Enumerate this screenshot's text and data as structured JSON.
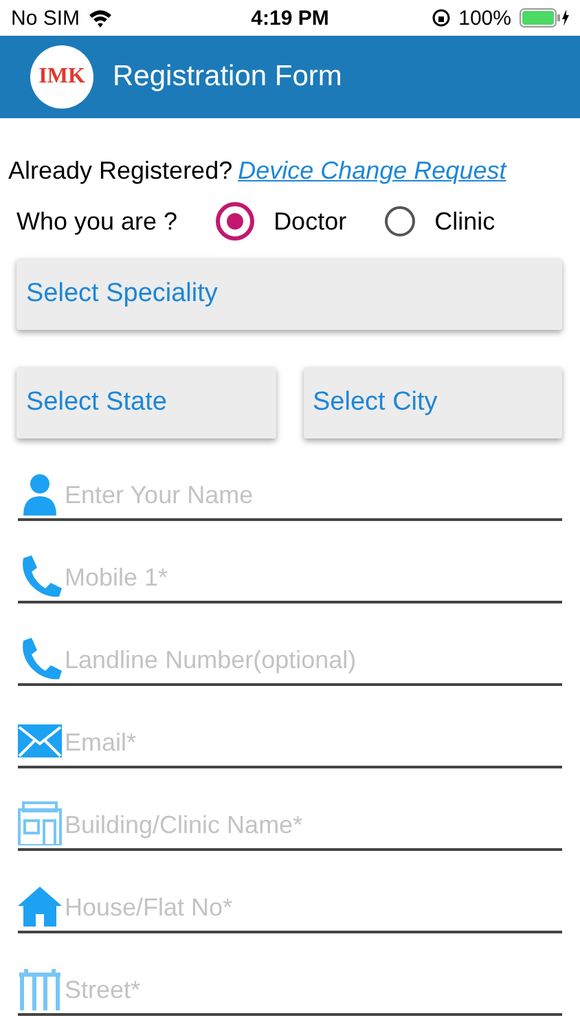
{
  "status_bar": {
    "carrier": "No SIM",
    "time": "4:19 PM",
    "battery": "100%"
  },
  "header": {
    "logo": "IMK",
    "title": "Registration Form"
  },
  "registered": {
    "text": "Already Registered?",
    "link": "Device Change Request"
  },
  "role": {
    "label": "Who you are ?",
    "options": [
      {
        "label": "Doctor",
        "selected": true
      },
      {
        "label": "Clinic",
        "selected": false
      }
    ]
  },
  "dropdowns": [
    {
      "placeholder": "Select Speciality"
    }
  ],
  "dropdown_pair": [
    {
      "placeholder": "Select State"
    },
    {
      "placeholder": "Select City"
    }
  ],
  "fields": [
    {
      "kind": "person",
      "placeholder": "Enter Your Name"
    },
    {
      "kind": "phone",
      "placeholder": "Mobile 1*"
    },
    {
      "kind": "phone",
      "placeholder": "Landline Number(optional)"
    },
    {
      "kind": "mail",
      "placeholder": "Email*"
    },
    {
      "kind": "building",
      "placeholder": "Building/Clinic Name*"
    },
    {
      "kind": "house",
      "placeholder": "House/Flat No*"
    },
    {
      "kind": "street",
      "placeholder": "Street*"
    }
  ]
}
